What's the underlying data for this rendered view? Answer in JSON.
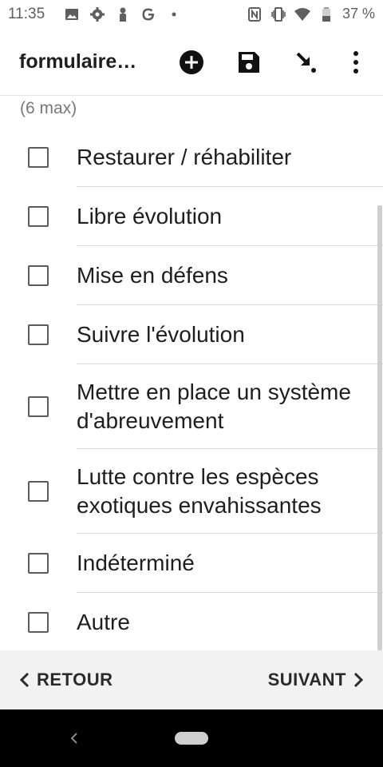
{
  "status_bar": {
    "time": "11:35",
    "battery_text": "37 %",
    "left_icons": [
      "image-icon",
      "gear-icon",
      "person-icon",
      "google-icon",
      "dot-icon"
    ],
    "right_icons": [
      "nfc-icon",
      "vibrate-icon",
      "wifi-icon",
      "battery-icon"
    ]
  },
  "app_bar": {
    "title": "formulaire…",
    "actions": [
      "add-icon",
      "save-icon",
      "jump-icon",
      "more-vert-icon"
    ]
  },
  "question": {
    "hint": "(6 max)",
    "options": [
      {
        "label": "Restaurer / réhabiliter",
        "checked": false
      },
      {
        "label": "Libre évolution",
        "checked": false
      },
      {
        "label": "Mise en défens",
        "checked": false
      },
      {
        "label": "Suivre l'évolution",
        "checked": false
      },
      {
        "label": "Mettre en place un système d'abreuvement",
        "checked": false
      },
      {
        "label": "Lutte contre les espèces exotiques envahissantes",
        "checked": false
      },
      {
        "label": "Indéterminé",
        "checked": false
      },
      {
        "label": "Autre",
        "checked": false
      }
    ]
  },
  "bottom_nav": {
    "back_label": "RETOUR",
    "next_label": "SUIVANT"
  },
  "colors": {
    "text": "#1e1e1e",
    "hint": "#777777",
    "checkbox_border": "#5b5b5b",
    "divider": "#d9d9d9",
    "bottom_nav_bg": "#f2f2f2",
    "system_nav_bg": "#000000"
  }
}
